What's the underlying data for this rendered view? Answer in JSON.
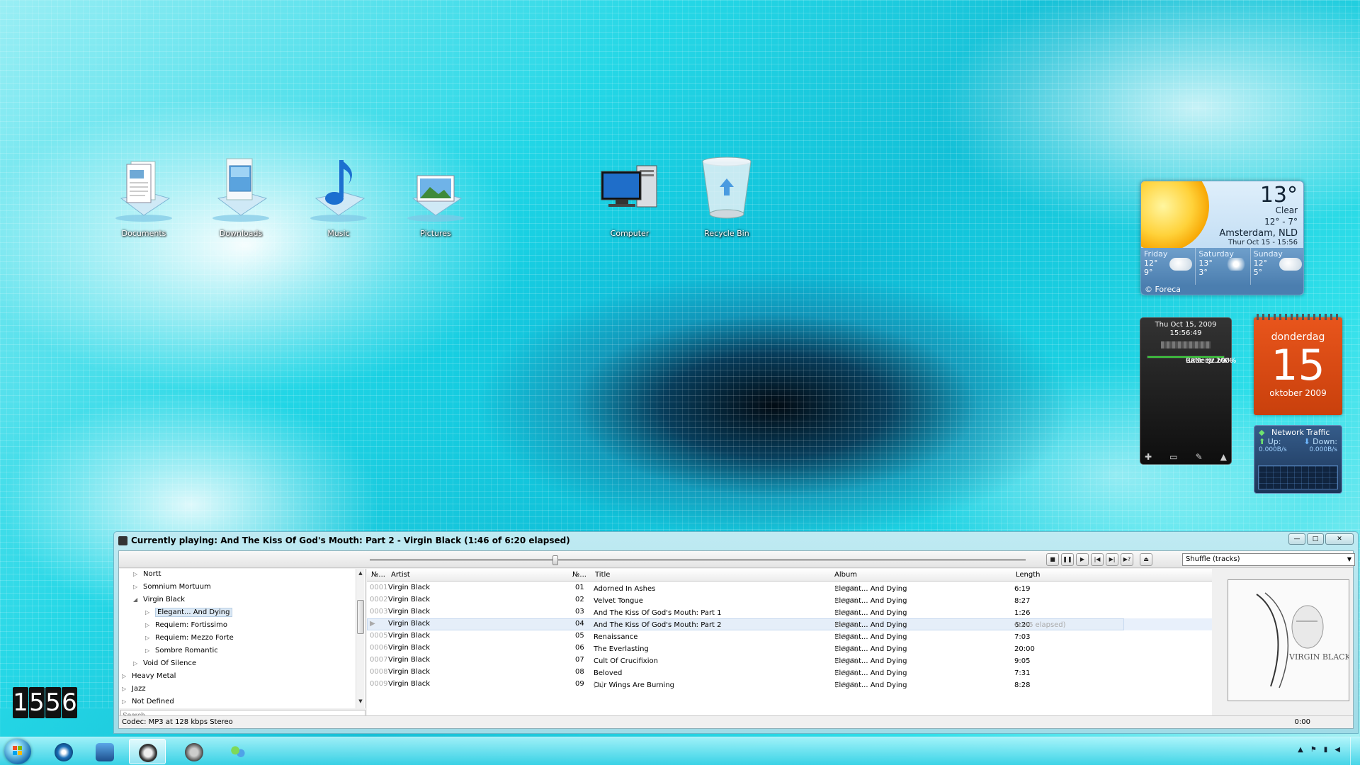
{
  "desktop": {
    "icons": [
      {
        "label": "Documents"
      },
      {
        "label": "Downloads"
      },
      {
        "label": "Music"
      },
      {
        "label": "Pictures"
      },
      {
        "label": "Computer"
      },
      {
        "label": "Recycle Bin"
      }
    ]
  },
  "weather": {
    "temp": "13°",
    "condition": "Clear",
    "range": "12° - 7°",
    "city": "Amsterdam, NLD",
    "updated": "Thur Oct 15 - 15:56",
    "forecast": [
      {
        "day": "Friday",
        "high": "12°",
        "low": "9°"
      },
      {
        "day": "Saturday",
        "high": "13°",
        "low": "3°"
      },
      {
        "day": "Sunday",
        "high": "12°",
        "low": "5°"
      }
    ],
    "credit": "© Foreca"
  },
  "meter": {
    "date": "Thu Oct 15, 2009",
    "time": "15:56:49",
    "cpu_label": "CPU: 19.2%",
    "cpu": 0.192,
    "ram_label": "RAM: 32.69%",
    "ram": 0.3269,
    "battery_label": "Battery: 100%",
    "battery": 1.0,
    "bar_color_low": "#e7b400",
    "bar_color_ok": "#3ccf3c"
  },
  "calendar": {
    "weekday": "donderdag",
    "day": "15",
    "month": "oktober 2009",
    "color": "#d94a12"
  },
  "network": {
    "title": "Network Traffic",
    "up_label": "Up:",
    "down_label": "Down:",
    "up_speed": "0.000B/s",
    "down_speed": "0.000B/s"
  },
  "player": {
    "title": "Currently playing: And The Kiss Of God's Mouth: Part 2 - Virgin Black (1:46 of 6:20 elapsed)",
    "progress": 0.279,
    "shuffle": "Shuffle (tracks)",
    "search_placeholder": "Search",
    "tree": [
      {
        "label": "Nortt",
        "level": 1,
        "state": "collapsed"
      },
      {
        "label": "Somnium Mortuum",
        "level": 1,
        "state": "collapsed"
      },
      {
        "label": "Virgin Black",
        "level": 1,
        "state": "expanded"
      },
      {
        "label": "Elegant... And Dying",
        "level": 2,
        "state": "collapsed",
        "selected": true
      },
      {
        "label": "Requiem: Fortissimo",
        "level": 2,
        "state": "collapsed"
      },
      {
        "label": "Requiem: Mezzo Forte",
        "level": 2,
        "state": "collapsed"
      },
      {
        "label": "Sombre Romantic",
        "level": 2,
        "state": "collapsed"
      },
      {
        "label": "Void Of Silence",
        "level": 1,
        "state": "collapsed"
      },
      {
        "label": "Heavy Metal",
        "level": 0,
        "state": "collapsed"
      },
      {
        "label": "Jazz",
        "level": 0,
        "state": "collapsed"
      },
      {
        "label": "Not Defined",
        "level": 0,
        "state": "collapsed"
      }
    ],
    "columns": [
      "№...",
      "Artist",
      "№...",
      "Title",
      "Album",
      "Length"
    ],
    "tracks": [
      {
        "num": "0001",
        "artist": "Virgin Black",
        "track": "01",
        "title": "Adorned In Ashes",
        "album": "Elegant... And Dying",
        "year": "(2003)",
        "length": "6:19"
      },
      {
        "num": "0002",
        "artist": "Virgin Black",
        "track": "02",
        "title": "Velvet Tongue",
        "album": "Elegant... And Dying",
        "year": "(2003)",
        "length": "8:27"
      },
      {
        "num": "0003",
        "artist": "Virgin Black",
        "track": "03",
        "title": "And The Kiss Of God's Mouth: Part 1",
        "album": "Elegant... And Dying",
        "year": "(2003)",
        "length": "1:26"
      },
      {
        "num": "▶",
        "artist": "Virgin Black",
        "track": "04",
        "title": "And The Kiss Of God's Mouth: Part 2",
        "album": "Elegant... And Dying",
        "year": "(2003)",
        "length": "6:20",
        "extra": "(1:46 elapsed)",
        "playing": true
      },
      {
        "num": "0005",
        "artist": "Virgin Black",
        "track": "05",
        "title": "Renaissance",
        "album": "Elegant... And Dying",
        "year": "(2003)",
        "length": "7:03"
      },
      {
        "num": "0006",
        "artist": "Virgin Black",
        "track": "06",
        "title": "The Everlasting",
        "album": "Elegant... And Dying",
        "year": "(2003)",
        "length": "20:00"
      },
      {
        "num": "0007",
        "artist": "Virgin Black",
        "track": "07",
        "title": "Cult Of Crucifixion",
        "album": "Elegant... And Dying",
        "year": "(2003)",
        "length": "9:05"
      },
      {
        "num": "0008",
        "artist": "Virgin Black",
        "track": "08",
        "title": "Beloved",
        "album": "Elegant... And Dying",
        "year": "(2003)",
        "length": "7:31"
      },
      {
        "num": "0009",
        "artist": "Virgin Black",
        "track": "09",
        "title": "Our Wings Are Burning",
        "title_extra": "[1]",
        "album": "Elegant... And Dying",
        "year": "(2003)",
        "length": "8:28"
      }
    ],
    "art_text": "VIRGIN BLACK",
    "codec": "Codec: MP3 at 128 kbps Stereo",
    "time": "0:00"
  },
  "clock": {
    "digits": [
      "1",
      "5",
      "5",
      "6"
    ]
  },
  "taskbar": {
    "buttons": [
      {
        "name": "winamp"
      },
      {
        "name": "media-center"
      },
      {
        "name": "music-player",
        "active": true
      },
      {
        "name": "shield"
      },
      {
        "name": "messenger"
      }
    ]
  }
}
